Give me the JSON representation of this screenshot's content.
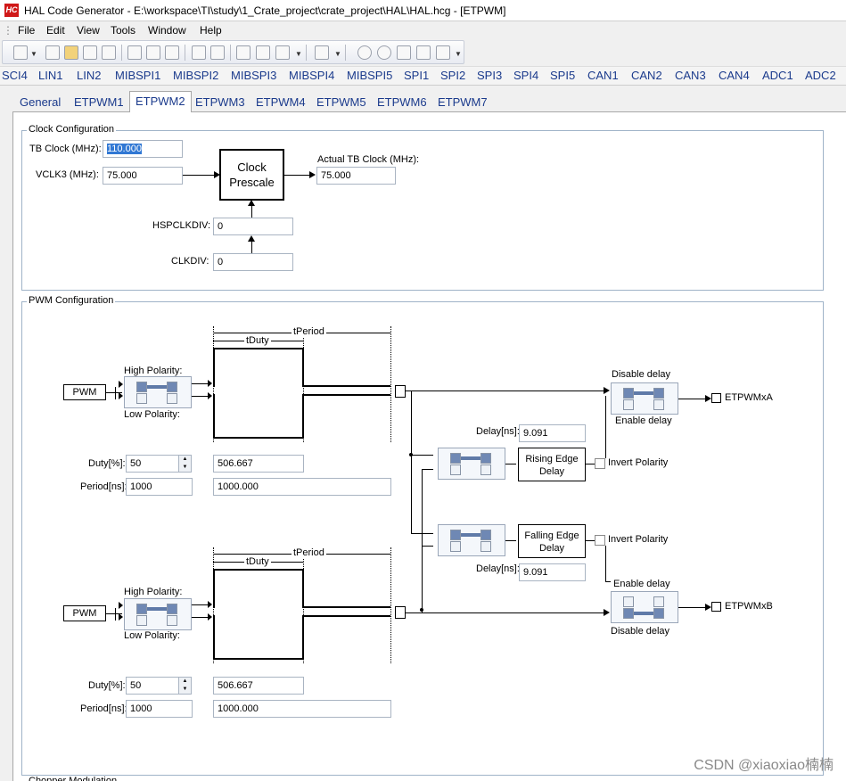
{
  "window": {
    "app_icon": "HC",
    "title": "HAL Code Generator - E:\\workspace\\TI\\study\\1_Crate_project\\crate_project\\HAL\\HAL.hcg - [ETPWM]"
  },
  "menu": [
    "File",
    "Edit",
    "View",
    "Tools",
    "Window",
    "Help"
  ],
  "module_tabs": [
    "SCI4",
    "LIN1",
    "LIN2",
    "MIBSPI1",
    "MIBSPI2",
    "MIBSPI3",
    "MIBSPI4",
    "MIBSPI5",
    "SPI1",
    "SPI2",
    "SPI3",
    "SPI4",
    "SPI5",
    "CAN1",
    "CAN2",
    "CAN3",
    "CAN4",
    "ADC1",
    "ADC2"
  ],
  "sub_tabs": [
    "General",
    "ETPWM1",
    "ETPWM2",
    "ETPWM3",
    "ETPWM4",
    "ETPWM5",
    "ETPWM6",
    "ETPWM7"
  ],
  "active_sub_tab": "ETPWM2",
  "clock": {
    "group_title": "Clock Configuration",
    "tb_clock_label": "TB Clock (MHz):",
    "tb_clock_value": "110.000",
    "vclk3_label": "VCLK3 (MHz):",
    "vclk3_value": "75.000",
    "prescale_line1": "Clock",
    "prescale_line2": "Prescale",
    "actual_label": "Actual TB  Clock (MHz):",
    "actual_value": "75.000",
    "hspclkdiv_label": "HSPCLKDIV:",
    "hspclkdiv_value": "0",
    "clkdiv_label": "CLKDIV:",
    "clkdiv_value": "0"
  },
  "pwm": {
    "group_title": "PWM Configuration",
    "channel_a": {
      "pwm_label": "PWM",
      "tperiod": "tPeriod",
      "tduty": "tDuty",
      "high_polarity": "High Polarity:",
      "low_polarity": "Low Polarity:",
      "duty_label": "Duty[%]:",
      "duty_value": "50",
      "duty_ns": "506.667",
      "period_label": "Period[ns]:",
      "period_value": "1000",
      "period_ns": "1000.000"
    },
    "channel_b": {
      "pwm_label": "PWM",
      "tperiod": "tPeriod",
      "tduty": "tDuty",
      "high_polarity": "High Polarity:",
      "low_polarity": "Low Polarity:",
      "duty_label": "Duty[%]:",
      "duty_value": "50",
      "duty_ns": "506.667",
      "period_label": "Period[ns]:",
      "period_value": "1000",
      "period_ns": "1000.000"
    },
    "rising": {
      "delay_label": "Delay[ns]:",
      "delay_value": "9.091",
      "box_line1": "Rising Edge",
      "box_line2": "Delay",
      "invert_label": "Invert Polarity"
    },
    "falling": {
      "delay_label": "Delay[ns]:",
      "delay_value": "9.091",
      "box_line1": "Falling Edge",
      "box_line2": "Delay",
      "invert_label": "Invert Polarity"
    },
    "out_a": {
      "top": "Disable delay",
      "bottom": "Enable delay",
      "name": "ETPWMxA"
    },
    "out_b": {
      "top": "Enable delay",
      "bottom": "Disable delay",
      "name": "ETPWMxB"
    }
  },
  "next_group": "Chopper Modulation",
  "watermark": "CSDN @xiaoxiao楠楠"
}
